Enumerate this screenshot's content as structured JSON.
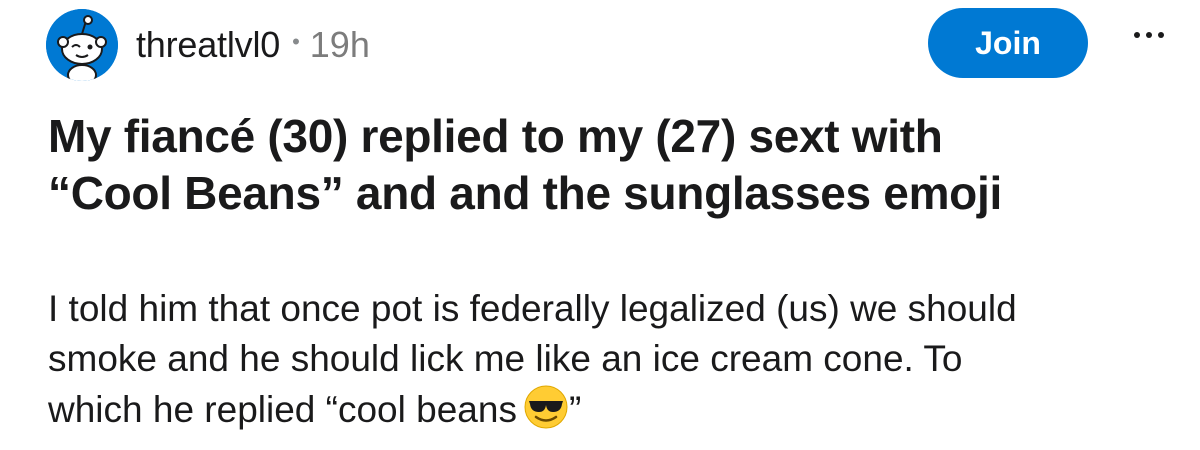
{
  "post": {
    "author": "threatlvl0",
    "separator": "•",
    "age": "19h",
    "join_label": "Join",
    "more_icon": "more-horizontal-icon",
    "title_line1": "My fiancé (30) replied to my (27) sext with",
    "title_line2": "“Cool Beans” and and the sunglasses emoji",
    "body_line1": "I told him that once pot is federally legalized (us) we should",
    "body_line2": "smoke and he should lick me like an ice cream cone. To",
    "body_line3_start": "which he replied “cool beans",
    "body_line3_end": "”",
    "emoji": "smiling-face-with-sunglasses",
    "avatar_icon": "reddit-snoo-avatar-icon"
  },
  "colors": {
    "accent": "#0079d3",
    "text": "#1a1a1b",
    "meta": "#7c7c7c"
  }
}
